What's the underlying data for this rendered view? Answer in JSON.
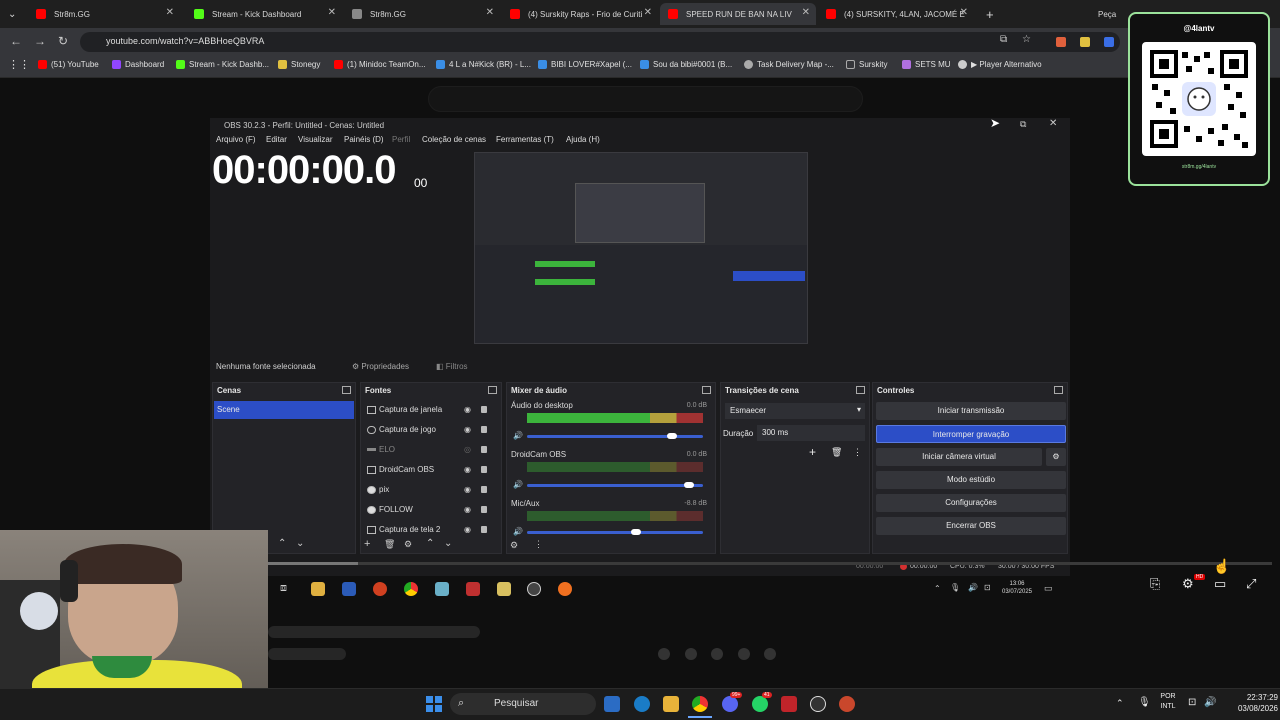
{
  "browser": {
    "tabs": [
      {
        "label": "Str8m.GG",
        "color": "#ff0000"
      },
      {
        "label": "Stream - Kick Dashboard",
        "color": "#53fc18"
      },
      {
        "label": "Str8m.GG",
        "color": "#888888"
      },
      {
        "label": "(4) Surskity Raps - Frio de Curiti",
        "color": "#ff0000"
      },
      {
        "label": "SPEED RUN DE BAN NA LIV",
        "color": "#ff0000"
      },
      {
        "label": "(4) SURSKITY, 4LAN, JACOMÉ E",
        "color": "#ff0000"
      }
    ],
    "new_tab": "+",
    "right_tab_label": "Peça",
    "url": "youtube.com/watch?v=ABBHoeQBVRA",
    "bookmarks": [
      {
        "label": "(51) YouTube",
        "color": "#ff0000"
      },
      {
        "label": "Dashboard",
        "color": "#9146ff"
      },
      {
        "label": "Stream - Kick Dashb...",
        "color": "#53fc18"
      },
      {
        "label": "Stonegy",
        "color": "#e0c040"
      },
      {
        "label": "(1) Minidoc TeamOn...",
        "color": "#ff0000"
      },
      {
        "label": "4 L a N#Kick (BR) - L...",
        "color": "#3a8ee6"
      },
      {
        "label": "BIBI LOVER#Xapel (...",
        "color": "#3a8ee6"
      },
      {
        "label": "Sou da bibi#0001 (B...",
        "color": "#3a8ee6"
      },
      {
        "label": "Task Delivery Map -...",
        "color": "#aaaaaa"
      },
      {
        "label": "Surskity",
        "color": "#aaaaaa"
      },
      {
        "label": "SETS MU",
        "color": "#b070e0"
      },
      {
        "label": "▶ Player Alternativo",
        "color": "#cccccc"
      }
    ]
  },
  "obs": {
    "title": "OBS 30.2.3 - Perfil: Untitled - Cenas: Untitled",
    "menu": [
      "Arquivo (F)",
      "Editar",
      "Visualizar",
      "Painéis (D)",
      "Perfil",
      "Coleção de cenas",
      "Ferramentas (T)",
      "Ajuda (H)"
    ],
    "timer": "00:00:00.0",
    "timer_ms": "00",
    "no_source": "Nenhuma fonte selecionada",
    "properties": "Propriedades",
    "filters": "Filtros",
    "scenes_header": "Cenas",
    "scene_item": "Scene",
    "sources_header": "Fontes",
    "sources": [
      "Captura de janela",
      "Captura de jogo",
      "ELO",
      "DroidCam OBS",
      "pix",
      "FOLLOW",
      "Captura de tela 2"
    ],
    "mixer_header": "Mixer de áudio",
    "mixer": [
      {
        "name": "Áudio do desktop",
        "db": "0.0 dB",
        "level": 0.85
      },
      {
        "name": "DroidCam OBS",
        "db": "0.0 dB",
        "level": 0.95
      },
      {
        "name": "Mic/Aux",
        "db": "-8.8 dB",
        "level": 0.65
      }
    ],
    "transitions_header": "Transições de cena",
    "transition_value": "Esmaecer",
    "duration_label": "Duração",
    "duration_value": "300 ms",
    "controls_header": "Controles",
    "controls": [
      "Iniciar transmissão",
      "Interromper gravação",
      "Iniciar câmera virtual",
      "Modo estúdio",
      "Configurações",
      "Encerrar OBS"
    ],
    "status_time1": "00:00:00",
    "status_time2": "00:00:00",
    "cpu": "CPU: 0.3%",
    "fps": "30.00 / 30.00 FPS",
    "inner_clock_time": "13:06",
    "inner_clock_date": "03/07/2025"
  },
  "overlay": {
    "handle": "@4lantv",
    "url": "str8m.gg/4lantv"
  },
  "taskbar": {
    "search_placeholder": "Pesquisar",
    "lang_top": "POR",
    "lang_bottom": "INTL",
    "time": "22:37:29",
    "date": "03/08/2026",
    "badge1": "99+",
    "badge2": "41"
  }
}
